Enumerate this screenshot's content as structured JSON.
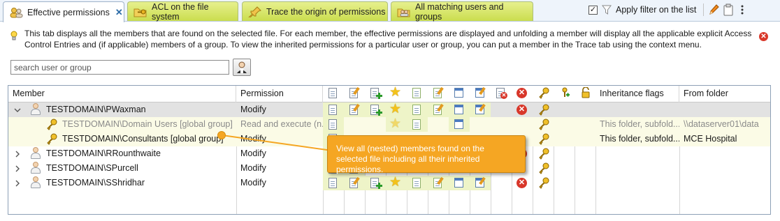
{
  "tabs": [
    {
      "label": "Effective permissions",
      "active": true,
      "closable": true,
      "icon": "users-icon"
    },
    {
      "label": "ACL on the file system",
      "icon": "folder-key-icon"
    },
    {
      "label": "Trace the origin of permissions",
      "icon": "pin-icon"
    },
    {
      "label": "All matching users and groups",
      "icon": "folder-users-icon"
    }
  ],
  "toolbar": {
    "filter_checked": true,
    "filter_label": "Apply filter on the list",
    "icons": [
      "funnel-icon",
      "pencil-icon",
      "clipboard-icon",
      "more-icon"
    ]
  },
  "info": {
    "text": "This tab displays all the members that are found on the selected file. For each member, the effective permissions are displayed and unfolding a member will display all the applicable explicit Access Control Entries and (if applicable) members of a group. To view the inherited permissions for a particular user or group, you can put a member in the Trace tab using the context menu."
  },
  "search": {
    "placeholder": "search user or group",
    "value": ""
  },
  "table": {
    "headers": {
      "member": "Member",
      "permission": "Permission",
      "inheritance": "Inheritance flags",
      "from_folder": "From folder"
    },
    "rows": [
      {
        "member": "TESTDOMAIN\\PWaxman",
        "permission": "Modify",
        "inheritance": "",
        "from_folder": "",
        "expanded": true,
        "kind": "user"
      },
      {
        "member": "TESTDOMAIN\\Domain Users [global group]",
        "permission": "Read and execute (n...",
        "inheritance": "This folder, subfold...",
        "from_folder": "\\\\dataserver01\\data",
        "kind": "group-child",
        "grey": true
      },
      {
        "member": "TESTDOMAIN\\Consultants [global group]",
        "permission": "Modify",
        "inheritance": "This folder, subfold...",
        "from_folder": "MCE Hospital",
        "kind": "group-child"
      },
      {
        "member": "TESTDOMAIN\\RRounthwaite",
        "permission": "Modify",
        "inheritance": "",
        "from_folder": "",
        "kind": "user"
      },
      {
        "member": "TESTDOMAIN\\SPurcell",
        "permission": "Modify",
        "inheritance": "",
        "from_folder": "",
        "kind": "user"
      },
      {
        "member": "TESTDOMAIN\\SShridhar",
        "permission": "Modify",
        "inheritance": "",
        "from_folder": "",
        "kind": "user"
      }
    ]
  },
  "callout": {
    "text": "View all (nested) members found on the selected file including all their inherited permissions."
  },
  "colors": {
    "tab_green": "#cadd4e",
    "callout_orange": "#f5a623",
    "deny_red": "#d8372a",
    "star_yellow": "#f3c21b"
  }
}
